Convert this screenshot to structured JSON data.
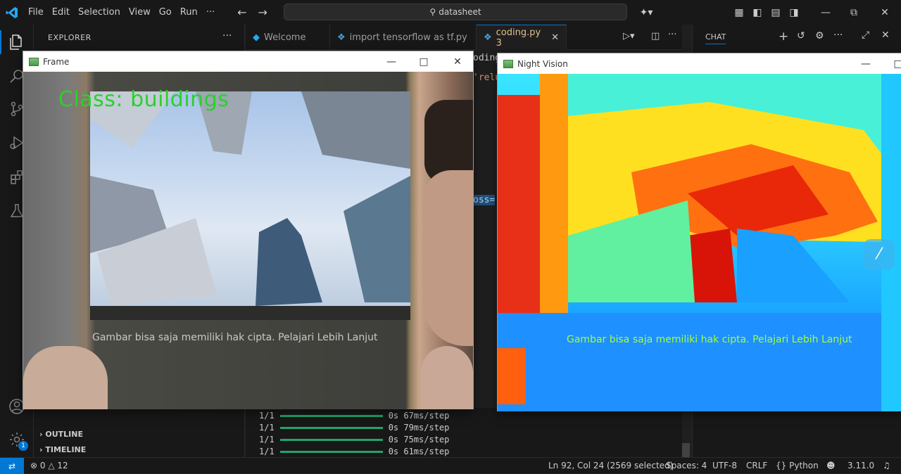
{
  "menu": [
    "File",
    "Edit",
    "Selection",
    "View",
    "Go",
    "Run",
    "···"
  ],
  "search": {
    "text": "datasheet"
  },
  "sidebar": {
    "title": "EXPLORER",
    "outline": "OUTLINE",
    "timeline": "TIMELINE"
  },
  "tabs": [
    {
      "label": "Welcome"
    },
    {
      "label": "import tensorflow as tf.py"
    },
    {
      "label": "coding.py 3"
    }
  ],
  "chat": {
    "title": "CHAT"
  },
  "editor_snippets": {
    "a": "oding",
    "b": "'relu",
    "c": "oss="
  },
  "terminal": {
    "lines": [
      {
        "count": "1/1",
        "time": "0s 67ms/step"
      },
      {
        "count": "1/1",
        "time": "0s 79ms/step"
      },
      {
        "count": "1/1",
        "time": "0s 75ms/step"
      },
      {
        "count": "1/1",
        "time": "0s 61ms/step"
      }
    ]
  },
  "status": {
    "errors": "0",
    "warnings": "12",
    "position": "Ln 92, Col 24 (2569 selected)",
    "spaces": "Spaces: 4",
    "encoding": "UTF-8",
    "eol": "CRLF",
    "language": "Python",
    "version": "3.11.0",
    "accounts_badge": "1"
  },
  "frame_window": {
    "title": "Frame",
    "label": "Class: buildings",
    "caption": "Gambar bisa saja memiliki hak cipta. Pelajari Lebih Lanjut"
  },
  "nightvision_window": {
    "title": "Night Vision",
    "caption": "Gambar bisa saja memiliki hak cipta. Pelajari Lebih Lanjut"
  },
  "colors": {
    "accent": "#0078d4",
    "label_green": "#2ad12a",
    "progress_green": "#23a36b",
    "nv_caption": "#a6ff38"
  }
}
